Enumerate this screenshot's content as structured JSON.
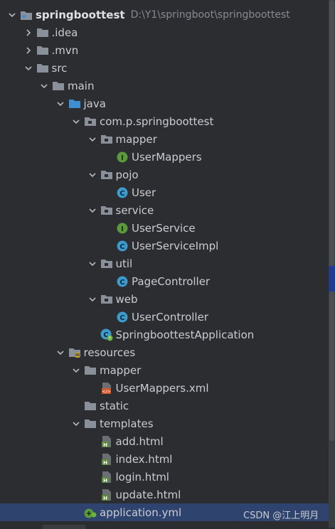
{
  "project": {
    "name": "springboottest",
    "path": "D:\\Y1\\springboot\\springboottest"
  },
  "tree": [
    {
      "label": "springboottest",
      "arrow": "down",
      "icon": "project-folder-icon",
      "level": 0
    },
    {
      "label": ".idea",
      "arrow": "right",
      "icon": "folder-icon",
      "level": 1
    },
    {
      "label": ".mvn",
      "arrow": "right",
      "icon": "folder-icon",
      "level": 1
    },
    {
      "label": "src",
      "arrow": "down",
      "icon": "folder-icon",
      "level": 1
    },
    {
      "label": "main",
      "arrow": "down",
      "icon": "folder-icon",
      "level": 2
    },
    {
      "label": "java",
      "arrow": "down",
      "icon": "source-folder-icon",
      "level": 3
    },
    {
      "label": "com.p.springboottest",
      "arrow": "down",
      "icon": "package-icon",
      "level": 4
    },
    {
      "label": "mapper",
      "arrow": "down",
      "icon": "package-icon",
      "level": 5
    },
    {
      "label": "UserMappers",
      "arrow": "none",
      "icon": "interface-icon",
      "level": 6
    },
    {
      "label": "pojo",
      "arrow": "down",
      "icon": "package-icon",
      "level": 5
    },
    {
      "label": "User",
      "arrow": "none",
      "icon": "class-icon",
      "level": 6
    },
    {
      "label": "service",
      "arrow": "down",
      "icon": "package-icon",
      "level": 5
    },
    {
      "label": "UserService",
      "arrow": "none",
      "icon": "interface-icon",
      "level": 6
    },
    {
      "label": "UserServiceImpl",
      "arrow": "none",
      "icon": "class-icon",
      "level": 6
    },
    {
      "label": "util",
      "arrow": "down",
      "icon": "package-icon",
      "level": 5
    },
    {
      "label": "PageController",
      "arrow": "none",
      "icon": "class-icon",
      "level": 6
    },
    {
      "label": "web",
      "arrow": "down",
      "icon": "package-icon",
      "level": 5
    },
    {
      "label": "UserController",
      "arrow": "none",
      "icon": "class-icon",
      "level": 6
    },
    {
      "label": "SpringboottestApplication",
      "arrow": "none",
      "icon": "spring-boot-class-icon",
      "level": 5
    },
    {
      "label": "resources",
      "arrow": "down",
      "icon": "resources-folder-icon",
      "level": 3
    },
    {
      "label": "mapper",
      "arrow": "down",
      "icon": "folder-icon",
      "level": 4
    },
    {
      "label": "UserMappers.xml",
      "arrow": "none",
      "icon": "xml-file-icon",
      "level": 5
    },
    {
      "label": "static",
      "arrow": "none",
      "icon": "folder-icon",
      "level": 4
    },
    {
      "label": "templates",
      "arrow": "down",
      "icon": "folder-icon",
      "level": 4
    },
    {
      "label": "add.html",
      "arrow": "none",
      "icon": "html-file-icon",
      "level": 5
    },
    {
      "label": "index.html",
      "arrow": "none",
      "icon": "html-file-icon",
      "level": 5
    },
    {
      "label": "login.html",
      "arrow": "none",
      "icon": "html-file-icon",
      "level": 5
    },
    {
      "label": "update.html",
      "arrow": "none",
      "icon": "html-file-icon",
      "level": 5
    },
    {
      "label": "application.yml",
      "arrow": "none",
      "icon": "yaml-config-icon",
      "level": 4,
      "selected": true
    }
  ],
  "watermark": "CSDN @江上明月",
  "colors": {
    "background": "#2b2d30",
    "selection": "#2e436e",
    "folder": "#8a9099",
    "source_folder": "#3d8fd1",
    "interface": "#5a9a3b",
    "class": "#3c9bcc",
    "xml": "#d4572a",
    "html": "#5b8a3a"
  }
}
